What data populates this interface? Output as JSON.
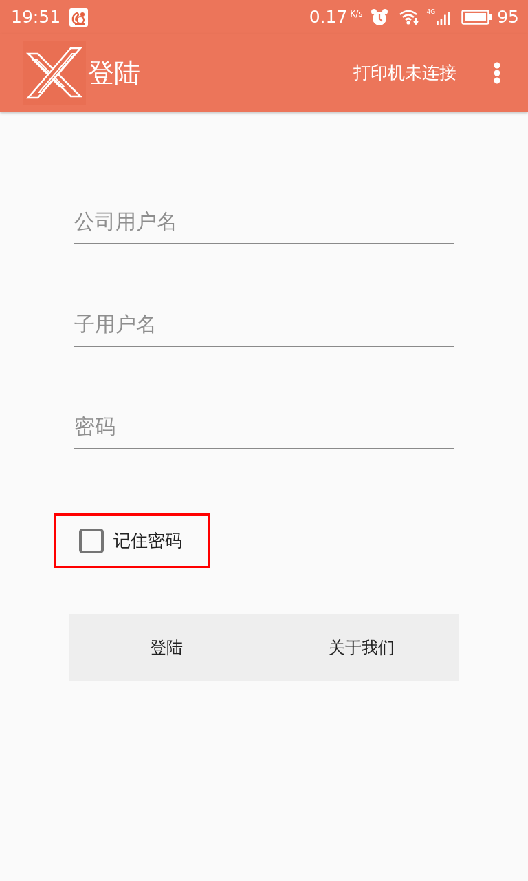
{
  "status_bar": {
    "time": "19:51",
    "network_speed": "0.17",
    "speed_unit": "K/s",
    "network_type": "4G",
    "battery": "95"
  },
  "app_bar": {
    "title": "登陆",
    "printer_status": "打印机未连接"
  },
  "fields": [
    {
      "placeholder": "公司用户名"
    },
    {
      "placeholder": "子用户名"
    },
    {
      "placeholder": "密码"
    }
  ],
  "remember": {
    "label": "记住密码",
    "checked": false,
    "highlighted": true
  },
  "buttons": [
    {
      "label": "登陆"
    },
    {
      "label": "关于我们"
    }
  ]
}
